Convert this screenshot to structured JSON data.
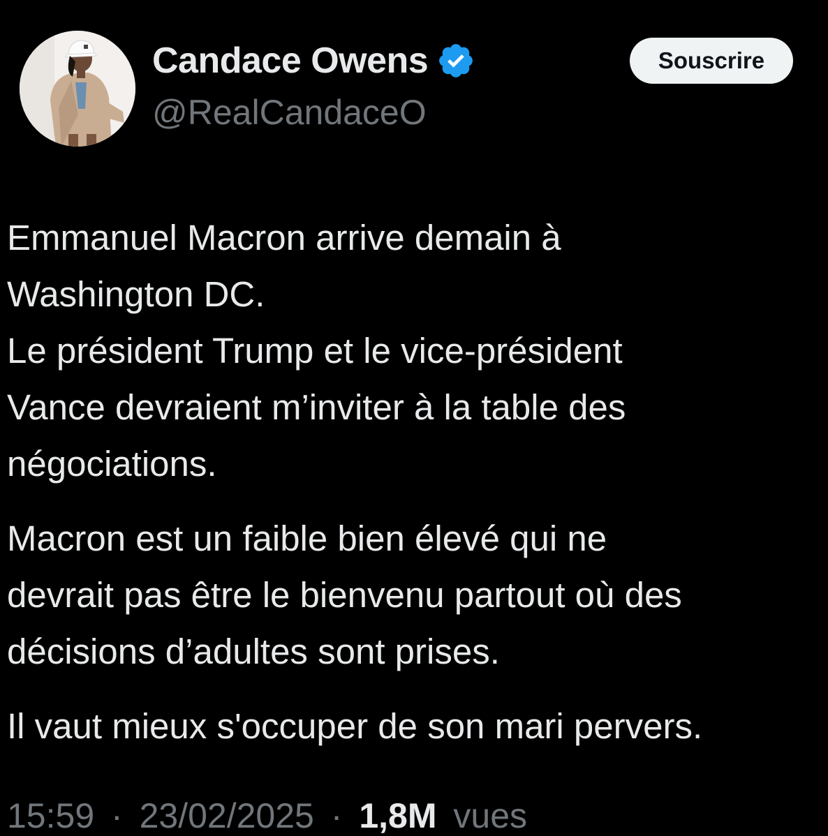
{
  "author": {
    "name": "Candace Owens",
    "handle": "@RealCandaceO",
    "verified": true,
    "avatar_icon": "profile-photo-avatar"
  },
  "actions": {
    "subscribe_label": "Souscrire"
  },
  "tweet": {
    "paragraphs": [
      {
        "lines": [
          "Emmanuel Macron arrive demain à",
          "Washington DC.",
          "Le président Trump et le vice-président",
          "Vance devraient m’inviter à la table des",
          "négociations."
        ]
      },
      {
        "lines": [
          "Macron est un faible bien élevé qui ne",
          "devrait pas être le bienvenu partout où des",
          "décisions d’adultes sont prises."
        ]
      },
      {
        "lines": [
          "Il vaut mieux s'occuper de son mari pervers."
        ]
      }
    ]
  },
  "meta": {
    "time": "15:59",
    "separator": "·",
    "date": "23/02/2025",
    "views_count": "1,8M",
    "views_label": "vues"
  },
  "colors": {
    "background": "#000000",
    "text": "#e7e9ea",
    "secondary_text": "#71767b",
    "verified_blue": "#1d9bf0",
    "button_bg": "#eff3f4"
  }
}
